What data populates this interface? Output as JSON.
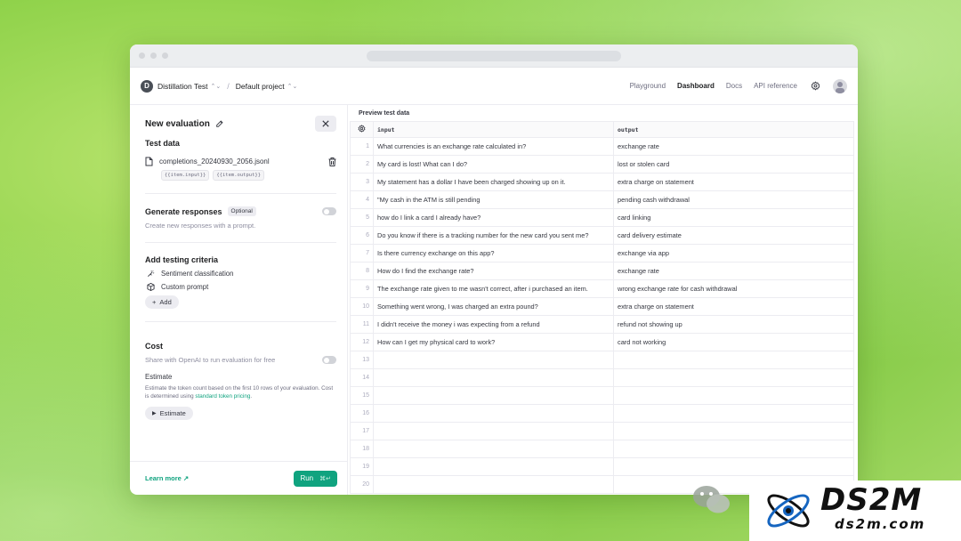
{
  "header": {
    "org_initial": "D",
    "org_name": "Distillation Test",
    "project_name": "Default project",
    "nav": [
      "Playground",
      "Dashboard",
      "Docs",
      "API reference"
    ],
    "active_nav": "Dashboard"
  },
  "panel": {
    "title": "New evaluation",
    "test_data": {
      "title": "Test data",
      "file_name": "completions_20240930_2056.jsonl",
      "tags": [
        "{{item.input}}",
        "{{item.output}}"
      ]
    },
    "generate": {
      "title": "Generate responses",
      "badge": "Optional",
      "desc": "Create new responses with a prompt."
    },
    "criteria": {
      "title": "Add testing criteria",
      "items": [
        "Sentiment classification",
        "Custom prompt"
      ],
      "add_label": "Add"
    },
    "cost": {
      "title": "Cost",
      "share_label": "Share with OpenAI to run evaluation for free",
      "estimate_title": "Estimate",
      "estimate_desc": "Estimate the token count based on the first 10 rows of your evaluation. Cost is determined using",
      "estimate_link": "standard token pricing",
      "estimate_button": "Estimate"
    },
    "footer": {
      "learn_more": "Learn more ↗",
      "run_label": "Run",
      "run_shortcut": "⌘↵"
    }
  },
  "preview": {
    "title": "Preview test data",
    "columns": [
      "input",
      "output"
    ],
    "rows": [
      {
        "n": "1",
        "input": "What currencies is an exchange rate calculated in?",
        "output": "exchange rate"
      },
      {
        "n": "2",
        "input": "My card is lost! What can I do?",
        "output": "lost or stolen card"
      },
      {
        "n": "3",
        "input": "My statement has a dollar I have been charged showing up on it.",
        "output": "extra charge on statement"
      },
      {
        "n": "4",
        "input": "\"My cash in the ATM is still pending",
        "output": "pending cash withdrawal"
      },
      {
        "n": "5",
        "input": "how do I link a card I already have?",
        "output": "card linking"
      },
      {
        "n": "6",
        "input": "Do you know if there is a tracking number for the new card you sent me?",
        "output": "card delivery estimate"
      },
      {
        "n": "7",
        "input": "Is there currency exchange on this app?",
        "output": "exchange via app"
      },
      {
        "n": "8",
        "input": "How do I find the exchange rate?",
        "output": "exchange rate"
      },
      {
        "n": "9",
        "input": "The exchange rate given to me wasn't correct, after i purchased an item.",
        "output": "wrong exchange rate for cash withdrawal"
      },
      {
        "n": "10",
        "input": "Something went wrong, I was charged an extra pound?",
        "output": "extra charge on statement"
      },
      {
        "n": "11",
        "input": "I didn't receive the money i was expecting from a refund",
        "output": "refund not showing up"
      },
      {
        "n": "12",
        "input": "How can I get my physical card to work?",
        "output": "card not working"
      },
      {
        "n": "13",
        "input": "",
        "output": ""
      },
      {
        "n": "14",
        "input": "",
        "output": ""
      },
      {
        "n": "15",
        "input": "",
        "output": ""
      },
      {
        "n": "16",
        "input": "",
        "output": ""
      },
      {
        "n": "17",
        "input": "",
        "output": ""
      },
      {
        "n": "18",
        "input": "",
        "output": ""
      },
      {
        "n": "19",
        "input": "",
        "output": ""
      },
      {
        "n": "20",
        "input": "",
        "output": ""
      }
    ]
  },
  "watermark": {
    "brand": "DS2M",
    "domain": "ds2m.com"
  },
  "colors": {
    "accent": "#10a37f",
    "background": "#8fd24a"
  }
}
